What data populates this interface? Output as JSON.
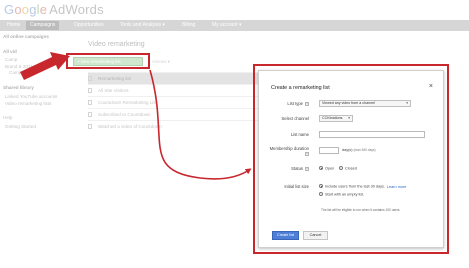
{
  "header": {
    "logo_google": [
      "G",
      "o",
      "o",
      "g",
      "l",
      "e"
    ],
    "logo_product": "AdWords"
  },
  "nav": {
    "items": [
      "Home",
      "Campaigns",
      "Opportunities",
      "Tools and Analysis ▾",
      "Billing",
      "My account ▾"
    ]
  },
  "sidebar": {
    "all_online_campaigns": "All online campaigns",
    "all_video": "All vid",
    "campaign_a": "Camp",
    "campaign_b": "Brand & 2011 - Video",
    "campaign_b2": "Campaign",
    "shared_library": "Shared library",
    "linked_accounts": "Linked YouTube accounts",
    "video_remarketing": "Video remarketing lists",
    "help": "Help",
    "getting_started": "Getting Started"
  },
  "main": {
    "title": "Video remarketing",
    "new_list_button": "+ New remarketing list",
    "secondary_button": "Actions ▾"
  },
  "table": {
    "rows": [
      "Remarketing list",
      "All Site Visitors",
      "Countdown Remarketing List",
      "Subscribed to Countdown",
      "Watched a video of Countdown"
    ]
  },
  "dialog": {
    "title": "Create a remarketing list",
    "close": "×",
    "list_type_label": "List type",
    "list_type_value": "Viewed any video from a channel",
    "select_channel_label": "Select channel",
    "select_channel_value": "CCKbrations",
    "list_name_label": "List name",
    "membership_label": "Membership duration",
    "membership_unit": "day(s)",
    "membership_note": "(max 540 days)",
    "status_label": "Status",
    "status_open": "Open",
    "status_closed": "Closed",
    "initial_size_label": "Initial list size",
    "option_include": "Include users from the last 30 days.",
    "learn_more": "Learn more",
    "option_empty": "Start with an empty list.",
    "eligibility_note": "The list will be eligible to run when it contains 100 users.",
    "create_button": "Create list",
    "cancel_button": "Cancel"
  },
  "colors": {
    "highlight_red": "#c8272d",
    "create_blue": "#4d7fd8"
  }
}
